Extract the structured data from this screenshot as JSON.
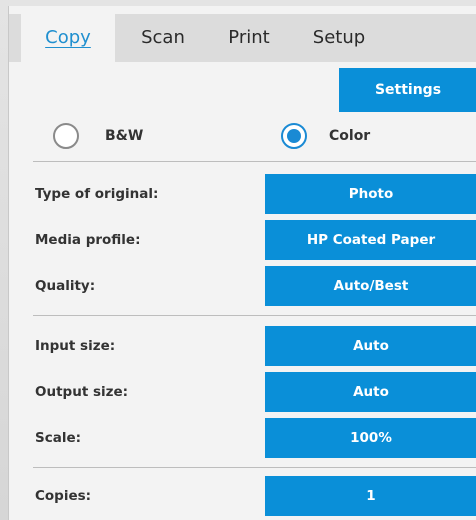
{
  "tabs": [
    {
      "label": "Copy",
      "active": true
    },
    {
      "label": "Scan",
      "active": false
    },
    {
      "label": "Print",
      "active": false
    },
    {
      "label": "Setup",
      "active": false
    }
  ],
  "settings_button": "Settings",
  "color_mode": {
    "options": [
      "B&W",
      "Color"
    ],
    "selected": "Color"
  },
  "rows": [
    {
      "label": "Type of original:",
      "value": "Photo"
    },
    {
      "label": "Media profile:",
      "value": "HP Coated Paper"
    },
    {
      "label": "Quality:",
      "value": "Auto/Best"
    },
    {
      "label": "Input size:",
      "value": "Auto"
    },
    {
      "label": "Output size:",
      "value": "Auto"
    },
    {
      "label": "Scale:",
      "value": "100%"
    },
    {
      "label": "Copies:",
      "value": "1"
    }
  ],
  "colors": {
    "accent": "#0a8fd8",
    "active_tab_text": "#1f8fcf"
  }
}
